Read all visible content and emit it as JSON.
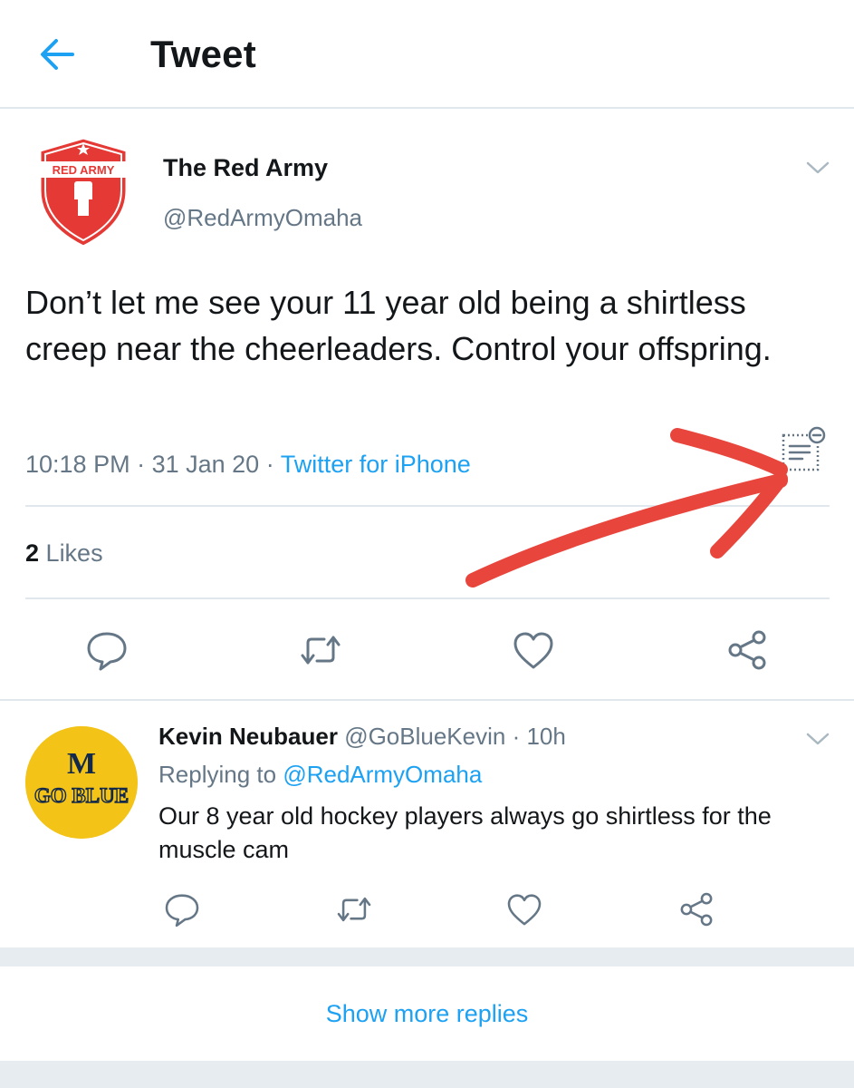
{
  "header": {
    "title": "Tweet"
  },
  "tweet": {
    "author_name": "The Red Army",
    "author_handle": "@RedArmyOmaha",
    "avatar_text": "RED ARMY",
    "text": "Don’t let me see your 11 year old being a shirtless creep near the cheerleaders. Control your offspring.",
    "time": "10:18 PM",
    "date": "31 Jan 20",
    "separator": " · ",
    "source": "Twitter for iPhone",
    "likes_count": "2",
    "likes_label": "Likes"
  },
  "reply": {
    "author_name": "Kevin Neubauer",
    "author_handle": "@GoBlueKevin",
    "time": "· 10h",
    "replying_prefix": "Replying to",
    "replying_to": "@RedArmyOmaha",
    "text": "Our 8 year old hockey players always go shirtless for the muscle cam",
    "avatar_letter": "M",
    "avatar_text": "GO BLUE"
  },
  "footer": {
    "show_more": "Show more replies"
  },
  "colors": {
    "accent": "#1da1f2",
    "text": "#14171a",
    "secondary": "#657786",
    "divider": "#e1e8ed",
    "annotation": "#e8453c",
    "redarmy": "#e53935",
    "goblue_yellow": "#f3c318",
    "goblue_navy": "#13294b"
  },
  "icons": {
    "back": "arrow-left-icon",
    "more": "chevron-down-icon",
    "reply": "speech-bubble-icon",
    "retweet": "retweet-icon",
    "like": "heart-icon",
    "share": "share-icon",
    "notes": "notes-icon"
  }
}
